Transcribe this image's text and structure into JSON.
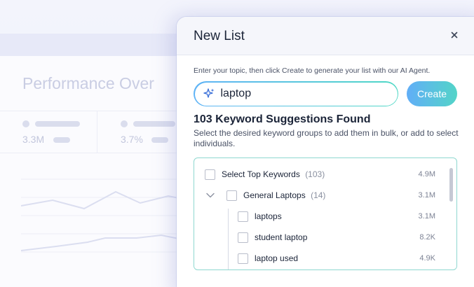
{
  "background": {
    "title": "Performance Over",
    "metrics": [
      {
        "value": "3.3M"
      },
      {
        "value": "3.7%"
      }
    ]
  },
  "modal": {
    "title": "New List",
    "intro": "Enter your topic, then click Create to generate your list with our AI Agent.",
    "search": {
      "value": "laptop",
      "icon": "sparkle-icon"
    },
    "create_label": "Create",
    "found_text": "103 Keyword Suggestions Found",
    "help_text": "Select the desired keyword groups to add them in bulk, or add to select individuals.",
    "rows": [
      {
        "label": "Select Top Keywords",
        "count": "(103)",
        "volume": "4.9M",
        "checked": false
      },
      {
        "label": "General Laptops",
        "count": "(14)",
        "volume": "3.1M",
        "checked": false,
        "expanded": true
      },
      {
        "label": "laptops",
        "count": "",
        "volume": "3.1M",
        "checked": false
      },
      {
        "label": "student laptop",
        "count": "",
        "volume": "8.2K",
        "checked": false
      },
      {
        "label": "laptop used",
        "count": "",
        "volume": "4.9K",
        "checked": false
      }
    ]
  },
  "colors": {
    "accent_start": "#61aef7",
    "accent_end": "#53d4c8",
    "text": "#1b2438"
  }
}
